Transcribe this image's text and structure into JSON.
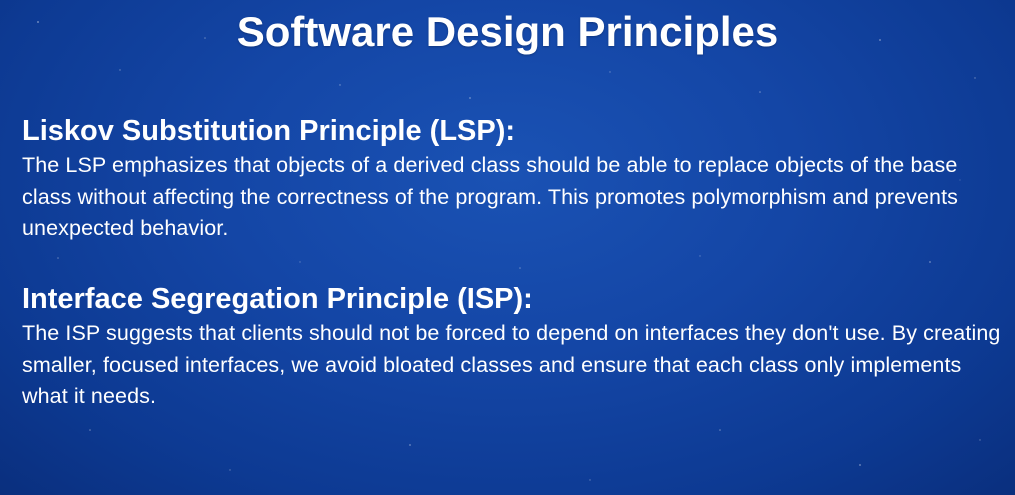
{
  "slide": {
    "title": "Software Design Principles",
    "sections": [
      {
        "heading": "Liskov Substitution Principle (LSP):",
        "body": "The LSP emphasizes that objects of a derived class should be able to replace objects of the base class without affecting the correctness of the program. This promotes polymorphism and prevents unexpected behavior."
      },
      {
        "heading": "Interface Segregation Principle (ISP):",
        "body": "The ISP suggests that clients should not be forced to depend on interfaces they don't use. By creating smaller, focused interfaces, we avoid bloated classes and ensure that each class only implements what it needs."
      }
    ]
  },
  "colors": {
    "background": "#1446a6",
    "text": "#ffffff"
  }
}
